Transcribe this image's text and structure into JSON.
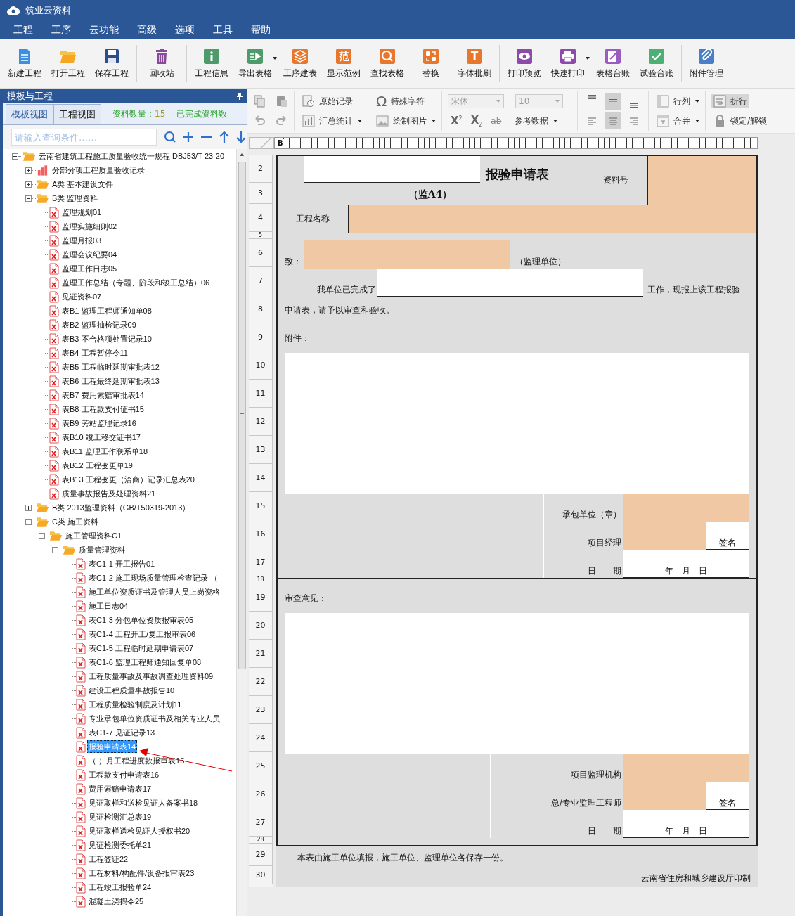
{
  "window": {
    "title": "筑业云资料"
  },
  "menu": [
    "工程",
    "工序",
    "云功能",
    "高级",
    "选项",
    "工具",
    "帮助"
  ],
  "toolbar": {
    "groups": [
      [
        {
          "label": "新建工程",
          "kind": "new-file",
          "dropdown": false
        },
        {
          "label": "打开工程",
          "kind": "folder",
          "dropdown": false
        },
        {
          "label": "保存工程",
          "kind": "save",
          "dropdown": false
        }
      ],
      [
        {
          "label": "回收站",
          "kind": "trash",
          "dropdown": false
        }
      ],
      [
        {
          "label": "工程信息",
          "kind": "info",
          "dropdown": false
        },
        {
          "label": "导出表格",
          "kind": "export",
          "dropdown": true
        },
        {
          "label": "工序建表",
          "kind": "layers",
          "dropdown": false
        },
        {
          "label": "显示范例",
          "kind": "glyph",
          "glyph": "范",
          "dropdown": false
        },
        {
          "label": "查找表格",
          "kind": "search",
          "dropdown": false
        },
        {
          "label": "替换",
          "kind": "replace",
          "dropdown": false
        },
        {
          "label": "字体批刷",
          "kind": "glyph",
          "glyph": "T",
          "dropdown": false
        }
      ],
      [
        {
          "label": "打印预览",
          "kind": "eye",
          "dropdown": false
        },
        {
          "label": "快速打印",
          "kind": "printer",
          "dropdown": true
        },
        {
          "label": "表格台账",
          "kind": "note",
          "dropdown": false
        },
        {
          "label": "试验台账",
          "kind": "check",
          "dropdown": false
        }
      ],
      [
        {
          "label": "附件管理",
          "kind": "clip",
          "dropdown": false
        }
      ]
    ]
  },
  "panel": {
    "title": "模板与工程",
    "tabs": [
      {
        "label": "模板视图",
        "selected": true
      },
      {
        "label": "工程视图",
        "selected": false
      }
    ],
    "count_label": "资料数量：",
    "count_value": "15",
    "completed_label": "已完成资料数",
    "search": {
      "placeholder": "请输入查询条件……"
    }
  },
  "tree": {
    "items": [
      {
        "label": "云南省建筑工程施工质量验收统一规程 DBJ53/T-23-20",
        "kind": "folder",
        "expanded": true,
        "selected": false,
        "children": [
          {
            "label": "分部分项工程质量验收记录",
            "kind": "chart",
            "expanded": false,
            "selected": false
          },
          {
            "label": "A类 基本建设文件",
            "kind": "folder",
            "expanded": false,
            "selected": false
          },
          {
            "label": "B类 监理资料",
            "kind": "folder",
            "expanded": true,
            "selected": false,
            "children": [
              {
                "label": "监理规划01",
                "kind": "doc",
                "selected": false
              },
              {
                "label": "监理实施细则02",
                "kind": "doc",
                "selected": false
              },
              {
                "label": "监理月报03",
                "kind": "doc",
                "selected": false
              },
              {
                "label": "监理会议纪要04",
                "kind": "doc",
                "selected": false
              },
              {
                "label": "监理工作日志05",
                "kind": "doc",
                "selected": false
              },
              {
                "label": "监理工作总结（专题、阶段和竣工总结）06",
                "kind": "doc",
                "selected": false
              },
              {
                "label": "见证资料07",
                "kind": "doc",
                "selected": false
              },
              {
                "label": "表B1 监理工程师通知单08",
                "kind": "doc",
                "selected": false
              },
              {
                "label": "表B2 监理抽检记录09",
                "kind": "doc",
                "selected": false
              },
              {
                "label": "表B3 不合格项处置记录10",
                "kind": "doc",
                "selected": false
              },
              {
                "label": "表B4 工程暂停令11",
                "kind": "doc",
                "selected": false
              },
              {
                "label": "表B5 工程临时延期审批表12",
                "kind": "doc",
                "selected": false
              },
              {
                "label": "表B6 工程最终延期审批表13",
                "kind": "doc",
                "selected": false
              },
              {
                "label": "表B7 费用索赔审批表14",
                "kind": "doc",
                "selected": false
              },
              {
                "label": "表B8 工程款支付证书15",
                "kind": "doc",
                "selected": false
              },
              {
                "label": "表B9 旁站监理记录16",
                "kind": "doc",
                "selected": false
              },
              {
                "label": "表B10 竣工移交证书17",
                "kind": "doc",
                "selected": false
              },
              {
                "label": "表B11 监理工作联系单18",
                "kind": "doc",
                "selected": false
              },
              {
                "label": "表B12 工程变更单19",
                "kind": "doc",
                "selected": false
              },
              {
                "label": "表B13 工程变更（洽商）记录汇总表20",
                "kind": "doc",
                "selected": false
              },
              {
                "label": "质量事故报告及处理资料21",
                "kind": "doc",
                "selected": false
              }
            ]
          },
          {
            "label": "B类 2013监理资料（GB/T50319-2013）",
            "kind": "folder",
            "expanded": false,
            "selected": false
          },
          {
            "label": "C类 施工资料",
            "kind": "folder",
            "expanded": true,
            "selected": false,
            "children": [
              {
                "label": "施工管理资料C1",
                "kind": "folder",
                "expanded": true,
                "selected": false,
                "children": [
                  {
                    "label": "质量管理资料",
                    "kind": "folder",
                    "expanded": true,
                    "selected": false,
                    "children": [
                      {
                        "label": "表C1-1 开工报告01",
                        "kind": "doc",
                        "selected": false
                      },
                      {
                        "label": "表C1-2 施工现场质量管理检查记录 （",
                        "kind": "doc",
                        "selected": false
                      },
                      {
                        "label": "施工单位资质证书及管理人员上岗资格",
                        "kind": "doc",
                        "selected": false
                      },
                      {
                        "label": "施工日志04",
                        "kind": "doc",
                        "selected": false
                      },
                      {
                        "label": "表C1-3 分包单位资质报审表05",
                        "kind": "doc",
                        "selected": false
                      },
                      {
                        "label": "表C1-4 工程开工/复工报审表06",
                        "kind": "doc",
                        "selected": false
                      },
                      {
                        "label": "表C1-5 工程临时延期申请表07",
                        "kind": "doc",
                        "selected": false
                      },
                      {
                        "label": "表C1-6 监理工程师通知回复单08",
                        "kind": "doc",
                        "selected": false
                      },
                      {
                        "label": "工程质量事故及事故调查处理资料09",
                        "kind": "doc",
                        "selected": false
                      },
                      {
                        "label": "建设工程质量事故报告10",
                        "kind": "doc",
                        "selected": false
                      },
                      {
                        "label": "工程质量检验制度及计划11",
                        "kind": "doc",
                        "selected": false
                      },
                      {
                        "label": "专业承包单位资质证书及相关专业人员",
                        "kind": "doc",
                        "selected": false
                      },
                      {
                        "label": "表C1-7 见证记录13",
                        "kind": "doc",
                        "selected": false
                      },
                      {
                        "label": "报验申请表14",
                        "kind": "doc",
                        "selected": true
                      },
                      {
                        "label": "（ ）月工程进度款报审表15",
                        "kind": "doc",
                        "selected": false
                      },
                      {
                        "label": "工程款支付申请表16",
                        "kind": "doc",
                        "selected": false
                      },
                      {
                        "label": "费用索赔申请表17",
                        "kind": "doc",
                        "selected": false
                      },
                      {
                        "label": "见证取样和送检见证人备案书18",
                        "kind": "doc",
                        "selected": false
                      },
                      {
                        "label": "见证检测汇总表19",
                        "kind": "doc",
                        "selected": false
                      },
                      {
                        "label": "见证取样送检见证人授权书20",
                        "kind": "doc",
                        "selected": false
                      },
                      {
                        "label": "见证检测委托单21",
                        "kind": "doc",
                        "selected": false
                      },
                      {
                        "label": "工程签证22",
                        "kind": "doc",
                        "selected": false
                      },
                      {
                        "label": "工程材料/构配件/设备报审表23",
                        "kind": "doc",
                        "selected": false
                      },
                      {
                        "label": "工程竣工报验单24",
                        "kind": "doc",
                        "selected": false
                      },
                      {
                        "label": "混凝土浇捣令25",
                        "kind": "doc",
                        "selected": false
                      }
                    ]
                  }
                ]
              }
            ]
          }
        ]
      }
    ]
  },
  "format_toolbar": {
    "edit_icons": [
      {
        "kind": "copy"
      },
      {
        "kind": "paste"
      },
      {
        "kind": "undo"
      },
      {
        "kind": "redo"
      }
    ],
    "record_buttons": [
      {
        "label": "原始记录",
        "kind": "record",
        "dropdown": false
      },
      {
        "label": "汇总统计",
        "kind": "stats",
        "dropdown": true
      }
    ],
    "insert_buttons": [
      {
        "label": "特殊字符",
        "kind": "omega",
        "glyph": "Ω",
        "dropdown": false
      },
      {
        "label": "绘制图片",
        "kind": "picture",
        "dropdown": true
      }
    ],
    "font_name": {
      "value": "宋体",
      "disabled": true
    },
    "font_size": {
      "value": "10",
      "disabled": true
    },
    "script_buttons": [
      {
        "kind": "superscript",
        "base": "X",
        "script": "2"
      },
      {
        "kind": "subscript",
        "base": "X",
        "script": "2"
      },
      {
        "kind": "strike",
        "base": "ab"
      }
    ],
    "reference": {
      "label": "参考数据",
      "dropdown": true
    },
    "align_buttons": [
      {
        "kind": "top",
        "selected": false
      },
      {
        "kind": "middle",
        "selected": true
      },
      {
        "kind": "bottom",
        "selected": false
      },
      {
        "kind": "left",
        "selected": false
      },
      {
        "kind": "center",
        "selected": true
      },
      {
        "kind": "right",
        "selected": false
      }
    ],
    "cell_buttons": [
      {
        "label": "行列",
        "kind": "rows",
        "dropdown": true
      },
      {
        "label": "合并",
        "kind": "merge",
        "dropdown": true
      }
    ],
    "wrap_buttons": [
      {
        "label": "折行",
        "kind": "wrap",
        "selected": true
      },
      {
        "label": "锁定/解锁",
        "kind": "lock",
        "selected": false
      }
    ]
  },
  "sheet": {
    "column_letter": "B",
    "row_numbers": [
      "2",
      "3",
      "4",
      "5",
      "6",
      "7",
      "8",
      "9",
      "10",
      "11",
      "12",
      "13",
      "14",
      "15",
      "16",
      "17",
      "18",
      "19",
      "20",
      "21",
      "22",
      "23",
      "24",
      "25",
      "26",
      "27",
      "28",
      "29",
      "30"
    ],
    "form": {
      "title": "报验申请表",
      "code": "（监A4）",
      "doc_no_label": "资料号",
      "project_label": "工程名称",
      "to_label": "致：",
      "to_suffix": "（监理单位）",
      "done_prefix": "我单位已完成了",
      "done_suffix": "工作，现报上该工程报验",
      "request_line": "申请表，请予以审查和验收。",
      "attachment_label": "附件：",
      "contractor": {
        "unit_label": "承包单位（章）",
        "manager_label": "项目经理",
        "sign_label": "签名",
        "date_label": "日　　期",
        "date_value": "年　月　日"
      },
      "review_label": "审查意见：",
      "supervisor": {
        "unit_label": "项目监理机构",
        "manager_label": "总/专业监理工程师",
        "sign_label": "签名",
        "date_label": "日　　期",
        "date_value": "年　月　日"
      }
    },
    "footer_note": "本表由施工单位填报，施工单位、监理单位各保存一份。",
    "printer": "云南省住房和城乡建设厅印制"
  }
}
